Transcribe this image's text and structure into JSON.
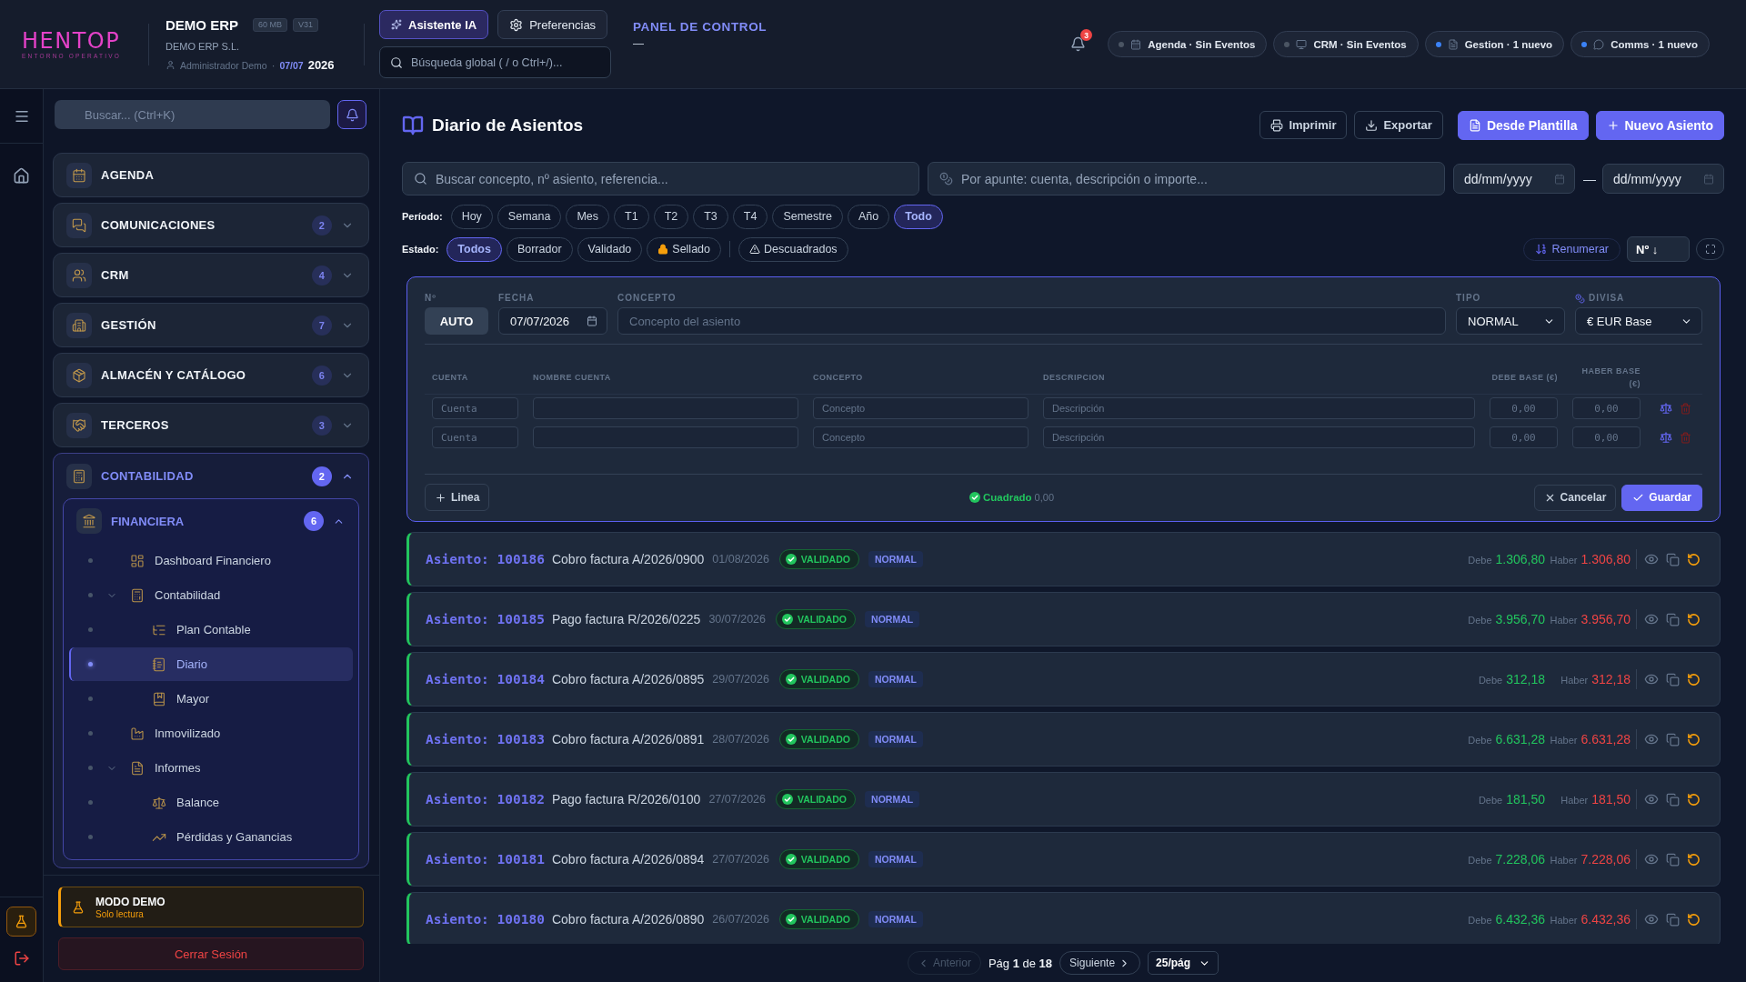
{
  "header": {
    "logo": {
      "name": "HENTOP",
      "tagline": "ENTORNO OPERATIVO"
    },
    "company": {
      "name": "DEMO ERP",
      "badges": [
        "60 MB",
        "V31"
      ],
      "legal_name": "DEMO ERP S.L.",
      "user": "Administrador Demo",
      "separator": "·",
      "date": "07/07",
      "year": "2026"
    },
    "buttons": [
      {
        "label": "Asistente IA",
        "active": true
      },
      {
        "label": "Preferencias",
        "active": false
      }
    ],
    "search": {
      "placeholder": "Búsqueda global ( / o Ctrl+/)..."
    },
    "panel": {
      "title": "PANEL DE CONTROL",
      "subtitle": "—"
    },
    "notifications": {
      "count": "3"
    },
    "pills": [
      {
        "label": "Agenda · Sin Eventos",
        "color": "#4b5563"
      },
      {
        "label": "CRM · Sin Eventos",
        "color": "#4b5563"
      },
      {
        "label": "Gestion · 1 nuevo",
        "color": "#3b82f6"
      },
      {
        "label": "Comms · 1 nuevo",
        "color": "#3b82f6"
      }
    ]
  },
  "sidebar": {
    "search": {
      "placeholder": "Buscar... (Ctrl+K)"
    },
    "sections": [
      {
        "label": "AGENDA"
      },
      {
        "label": "COMUNICACIONES",
        "count": "2",
        "expanded": false
      },
      {
        "label": "CRM",
        "count": "4",
        "expanded": false
      },
      {
        "label": "GESTIÓN",
        "count": "7",
        "expanded": false
      },
      {
        "label": "ALMACÉN Y CATÁLOGO",
        "count": "6",
        "expanded": false
      },
      {
        "label": "TERCEROS",
        "count": "3",
        "expanded": false
      },
      {
        "label": "CONTABILIDAD",
        "count": "2",
        "expanded": true,
        "children": [
          {
            "label": "FINANCIERA",
            "count": "6",
            "expanded": true,
            "children": [
              {
                "label": "Dashboard Financiero",
                "selected": false
              },
              {
                "label": "Contabilidad",
                "selected": false,
                "expanded": true,
                "children": [
                  {
                    "label": "Plan Contable",
                    "selected": false
                  },
                  {
                    "label": "Diario",
                    "selected": true
                  },
                  {
                    "label": "Mayor",
                    "selected": false
                  }
                ]
              },
              {
                "label": "Inmovilizado",
                "selected": false
              },
              {
                "label": "Informes",
                "selected": false,
                "expanded": true,
                "children": [
                  {
                    "label": "Balance",
                    "selected": false
                  },
                  {
                    "label": "Pérdidas y Ganancias",
                    "selected": false
                  }
                ]
              }
            ]
          }
        ]
      }
    ],
    "demo_mode": {
      "title": "MODO DEMO",
      "subtitle": "Solo lectura"
    },
    "logout": "Cerrar Sesión"
  },
  "page": {
    "title": "Diario de Asientos",
    "actions": [
      {
        "label": "Imprimir",
        "kind": "outline"
      },
      {
        "label": "Exportar",
        "kind": "outline"
      },
      {
        "label": "Desde Plantilla",
        "kind": "primary"
      },
      {
        "label": "Nuevo Asiento",
        "kind": "primary"
      }
    ]
  },
  "filters": {
    "search": {
      "placeholder": "Buscar concepto, nº asiento, referencia..."
    },
    "line_search": {
      "placeholder": "Por apunte: cuenta, descripción o importe..."
    },
    "date_from": {
      "placeholder": "dd/mm/yyyy"
    },
    "date_separator": "—",
    "date_to": {
      "placeholder": "dd/mm/yyyy"
    },
    "period": {
      "label": "Período:",
      "options": [
        {
          "label": "Hoy",
          "selected": false
        },
        {
          "label": "Semana",
          "selected": false
        },
        {
          "label": "Mes",
          "selected": false
        },
        {
          "label": "T1",
          "selected": false
        },
        {
          "label": "T2",
          "selected": false
        },
        {
          "label": "T3",
          "selected": false
        },
        {
          "label": "T4",
          "selected": false
        },
        {
          "label": "Semestre",
          "selected": false
        },
        {
          "label": "Año",
          "selected": false
        },
        {
          "label": "Todo",
          "selected": true
        }
      ]
    },
    "status": {
      "label": "Estado:",
      "options": [
        {
          "label": "Todos",
          "selected": true,
          "kind": "plain"
        },
        {
          "label": "Borrador",
          "selected": false,
          "kind": "plain"
        },
        {
          "label": "Validado",
          "selected": false,
          "kind": "plain"
        },
        {
          "label": "Sellado",
          "selected": false,
          "kind": "locked"
        },
        {
          "label": "Descuadrados",
          "selected": false,
          "kind": "warning"
        }
      ]
    },
    "renumber": "Renumerar",
    "sort": {
      "value": "Nº ↓"
    }
  },
  "entry_form": {
    "number": {
      "label": "Nº",
      "value": "AUTO"
    },
    "date": {
      "label": "FECHA",
      "value": "07/07/2026"
    },
    "concept": {
      "label": "CONCEPTO",
      "placeholder": "Concepto del asiento"
    },
    "type": {
      "label": "TIPO",
      "value": "NORMAL"
    },
    "currency": {
      "label": "DIVISA",
      "value": "€ EUR Base"
    },
    "columns": [
      "CUENTA",
      "NOMBRE CUENTA",
      "CONCEPTO",
      "DESCRIPCION",
      "DEBE BASE (€)",
      "HABER BASE (€)"
    ],
    "lines": [
      {
        "account": {
          "placeholder": "Cuenta"
        },
        "concept": {
          "placeholder": "Concepto"
        },
        "description": {
          "placeholder": "Descripción"
        },
        "debit": {
          "placeholder": "0,00"
        },
        "credit": {
          "placeholder": "0,00"
        }
      },
      {
        "account": {
          "placeholder": "Cuenta"
        },
        "concept": {
          "placeholder": "Concepto"
        },
        "description": {
          "placeholder": "Descripción"
        },
        "debit": {
          "placeholder": "0,00"
        },
        "credit": {
          "placeholder": "0,00"
        }
      }
    ],
    "add_line": "Linea",
    "balance": {
      "label": "Cuadrado",
      "amount": "0,00"
    },
    "cancel": "Cancelar",
    "save": "Guardar"
  },
  "entries": [
    {
      "title": "Asiento: 100186",
      "concept": "Cobro factura A/2026/0900",
      "date": "01/08/2026",
      "status": "VALIDADO",
      "type": "NORMAL",
      "debit_label": "Debe",
      "debit": "1.306,80",
      "credit_label": "Haber",
      "credit": "1.306,80"
    },
    {
      "title": "Asiento: 100185",
      "concept": "Pago factura R/2026/0225",
      "date": "30/07/2026",
      "status": "VALIDADO",
      "type": "NORMAL",
      "debit_label": "Debe",
      "debit": "3.956,70",
      "credit_label": "Haber",
      "credit": "3.956,70"
    },
    {
      "title": "Asiento: 100184",
      "concept": "Cobro factura A/2026/0895",
      "date": "29/07/2026",
      "status": "VALIDADO",
      "type": "NORMAL",
      "debit_label": "Debe",
      "debit": "312,18",
      "credit_label": "Haber",
      "credit": "312,18"
    },
    {
      "title": "Asiento: 100183",
      "concept": "Cobro factura A/2026/0891",
      "date": "28/07/2026",
      "status": "VALIDADO",
      "type": "NORMAL",
      "debit_label": "Debe",
      "debit": "6.631,28",
      "credit_label": "Haber",
      "credit": "6.631,28"
    },
    {
      "title": "Asiento: 100182",
      "concept": "Pago factura R/2026/0100",
      "date": "27/07/2026",
      "status": "VALIDADO",
      "type": "NORMAL",
      "debit_label": "Debe",
      "debit": "181,50",
      "credit_label": "Haber",
      "credit": "181,50"
    },
    {
      "title": "Asiento: 100181",
      "concept": "Cobro factura A/2026/0894",
      "date": "27/07/2026",
      "status": "VALIDADO",
      "type": "NORMAL",
      "debit_label": "Debe",
      "debit": "7.228,06",
      "credit_label": "Haber",
      "credit": "7.228,06"
    },
    {
      "title": "Asiento: 100180",
      "concept": "Cobro factura A/2026/0890",
      "date": "26/07/2026",
      "status": "VALIDADO",
      "type": "NORMAL",
      "debit_label": "Debe",
      "debit": "6.432,36",
      "credit_label": "Haber",
      "credit": "6.432,36"
    }
  ],
  "pagination": {
    "previous": {
      "label": "Anterior",
      "disabled": true
    },
    "page": "Pág **1** de **18**",
    "next": {
      "label": "Siguiente",
      "disabled": false
    },
    "page_size": "25/pág"
  }
}
